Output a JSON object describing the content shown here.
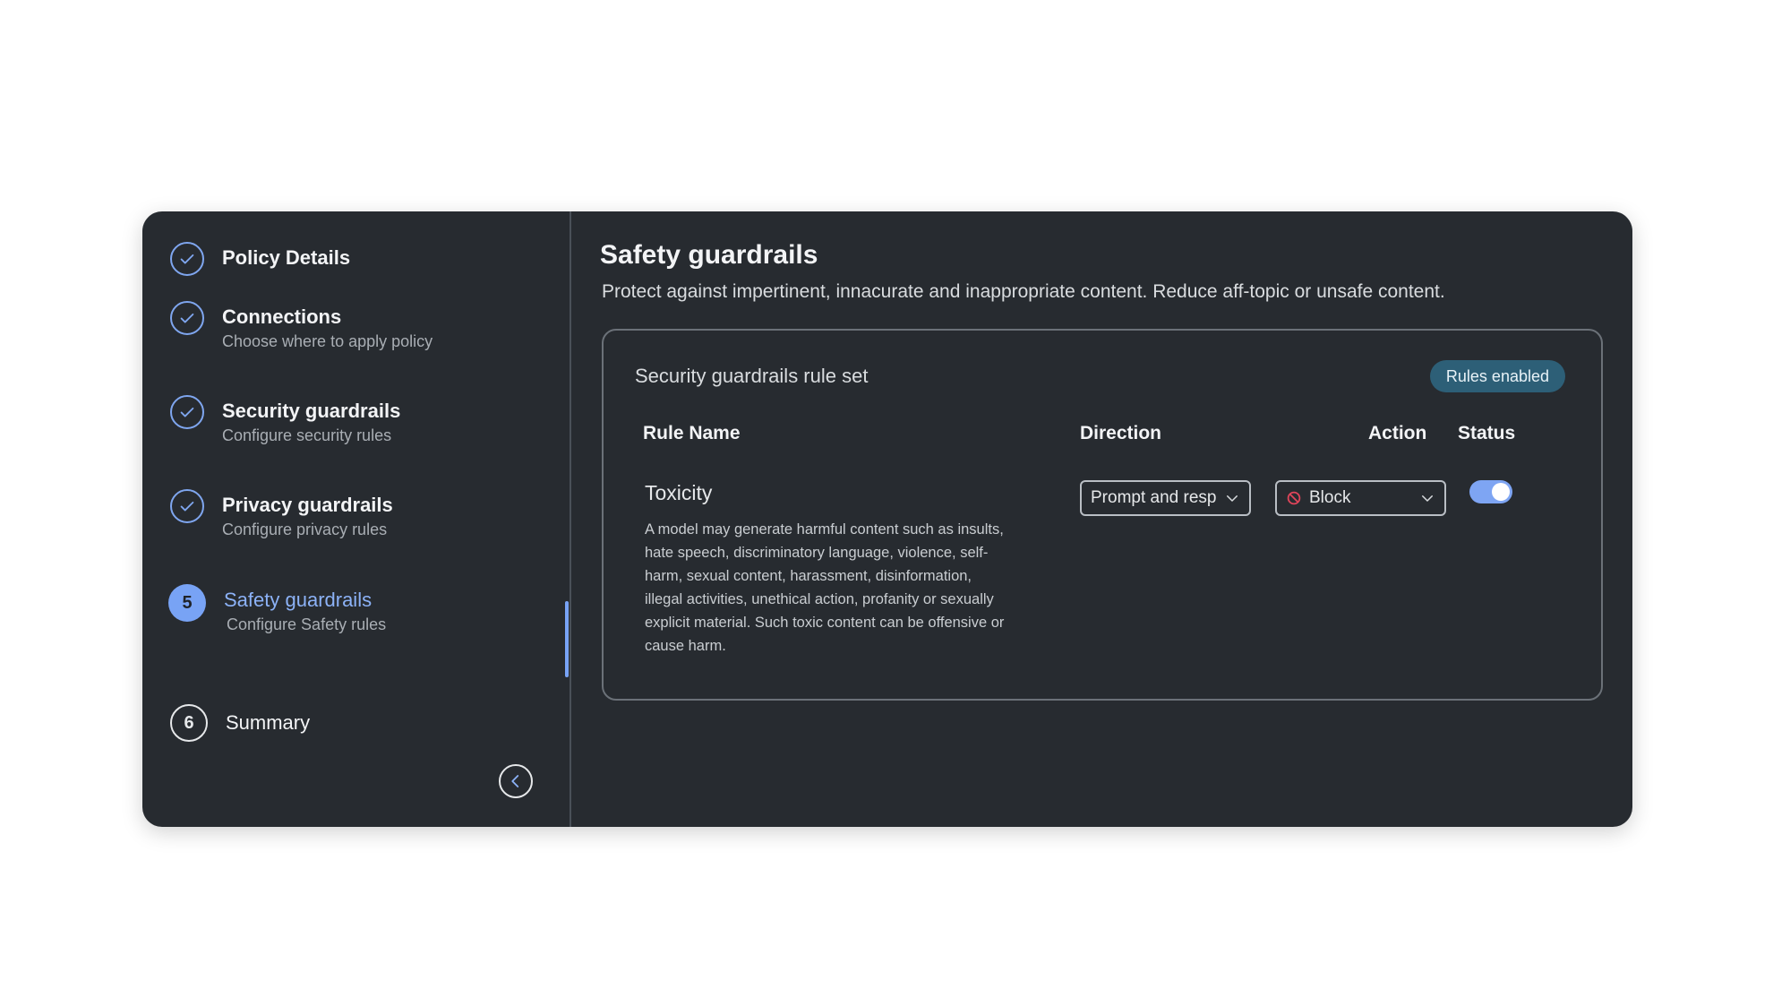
{
  "steps": [
    {
      "title": "Policy Details",
      "subtitle": "",
      "state": "done",
      "icon": "check-icon"
    },
    {
      "title": "Connections",
      "subtitle": "Choose where to apply policy",
      "state": "done",
      "icon": "check-icon"
    },
    {
      "title": "Security guardrails",
      "subtitle": "Configure security rules",
      "state": "done",
      "icon": "check-icon"
    },
    {
      "title": "Privacy guardrails",
      "subtitle": "Configure privacy rules",
      "state": "done",
      "icon": "check-icon"
    },
    {
      "title": "Safety guardrails",
      "subtitle": "Configure Safety rules",
      "state": "active",
      "number": "5"
    },
    {
      "title": "Summary",
      "subtitle": "",
      "state": "pending",
      "number": "6"
    }
  ],
  "collapse_icon": "chevron-left-icon",
  "main": {
    "title": "Safety guardrails",
    "description": "Protect against impertinent, innacurate and inappropriate content. Reduce aff-topic or unsafe content.",
    "card": {
      "title": "Security guardrails rule set",
      "badge": "Rules enabled",
      "columns": {
        "rule_name": "Rule Name",
        "direction": "Direction",
        "action": "Action",
        "status": "Status"
      },
      "rules": [
        {
          "name": "Toxicity",
          "description": "A model may generate harmful content such as insults, hate speech, discriminatory language, violence, self-harm, sexual content, harassment, disinformation, illegal activities, unethical action, profanity or sexually explicit material. Such toxic content can be offensive or cause harm.",
          "direction": "Prompt and resp",
          "action": "Block",
          "action_icon": "block-icon",
          "enabled": true
        }
      ]
    }
  },
  "colors": {
    "panel_bg": "#272b30",
    "accent": "#78a3f5",
    "badge_bg": "#2d5f77",
    "block_red": "#e0455a"
  }
}
